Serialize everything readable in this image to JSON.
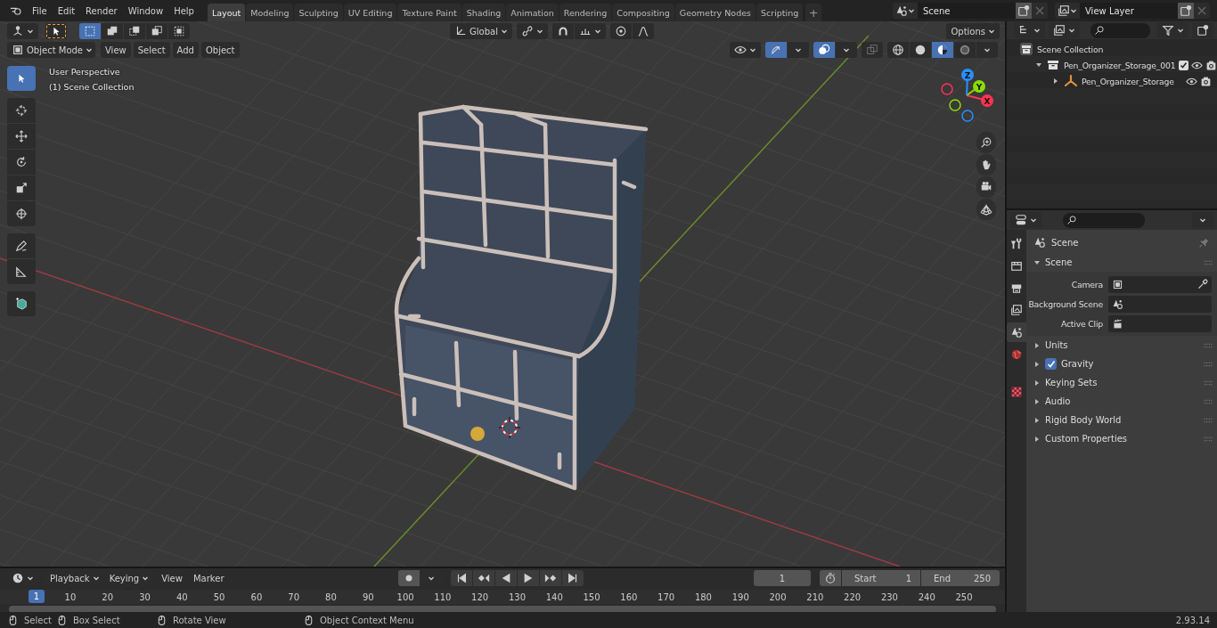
{
  "topbar": {
    "menus": [
      "File",
      "Edit",
      "Render",
      "Window",
      "Help"
    ],
    "workspaces": [
      {
        "label": "Layout",
        "selected": true
      },
      {
        "label": "Modeling",
        "selected": false
      },
      {
        "label": "Sculpting",
        "selected": false
      },
      {
        "label": "UV Editing",
        "selected": false
      },
      {
        "label": "Texture Paint",
        "selected": false
      },
      {
        "label": "Shading",
        "selected": false
      },
      {
        "label": "Animation",
        "selected": false
      },
      {
        "label": "Rendering",
        "selected": false
      },
      {
        "label": "Compositing",
        "selected": false
      },
      {
        "label": "Geometry Nodes",
        "selected": false
      },
      {
        "label": "Scripting",
        "selected": false
      }
    ],
    "add_tab": "+",
    "scene": "Scene",
    "view_layer": "View Layer"
  },
  "viewport": {
    "select_modes": [
      {
        "kind": "set",
        "selected": true
      },
      {
        "kind": "extend",
        "selected": false
      },
      {
        "kind": "subtract",
        "selected": false
      },
      {
        "kind": "difference",
        "selected": false
      },
      {
        "kind": "intersect",
        "selected": false
      }
    ],
    "transform_orientation": "Global",
    "options": "Options",
    "mode": "Object Mode",
    "menus": [
      "View",
      "Select",
      "Add",
      "Object"
    ],
    "toggles": [
      {
        "kind": "gizmo",
        "on": true
      },
      {
        "kind": "overlay",
        "on": true
      },
      {
        "kind": "xray",
        "on": false
      }
    ],
    "shading": [
      {
        "kind": "wireframe",
        "selected": false
      },
      {
        "kind": "solid",
        "selected": false
      },
      {
        "kind": "material",
        "selected": true
      },
      {
        "kind": "rendered",
        "selected": false
      }
    ],
    "tools": [
      {
        "kind": "select",
        "selected": true
      },
      {
        "kind": "cursor",
        "selected": false
      },
      {
        "kind": "move",
        "selected": false
      },
      {
        "kind": "rotate",
        "selected": false
      },
      {
        "kind": "scale",
        "selected": false
      },
      {
        "kind": "transform",
        "selected": false
      },
      {
        "kind": "annotate",
        "selected": false
      },
      {
        "kind": "measure",
        "selected": false
      },
      {
        "kind": "add-cube",
        "selected": false
      }
    ],
    "overlay_text": [
      "User Perspective",
      "(1) Scene Collection"
    ],
    "gizmo_axes": [
      {
        "label": "X",
        "color": "#ff3352"
      },
      {
        "label": "Y",
        "color": "#8bdc00"
      },
      {
        "label": "Z",
        "color": "#2890ff"
      }
    ]
  },
  "outliner": {
    "items": [
      {
        "label": "Scene Collection",
        "kind": "scene-collection",
        "children": [
          {
            "label": "Pen_Organizer_Storage_001",
            "kind": "collection",
            "expanded": true,
            "checked": true,
            "children": [
              {
                "label": "Pen_Organizer_Storage",
                "kind": "empty",
                "expanded": false
              }
            ]
          }
        ]
      }
    ]
  },
  "properties": {
    "tabs": [
      {
        "kind": "tool",
        "selected": false
      },
      {
        "kind": "render",
        "selected": false
      },
      {
        "kind": "output",
        "selected": false
      },
      {
        "kind": "view-layer",
        "selected": false
      },
      {
        "kind": "scene",
        "selected": true
      },
      {
        "kind": "world",
        "selected": false
      },
      {
        "kind": "texture",
        "selected": false
      }
    ],
    "context": "Scene",
    "panels": [
      {
        "label": "Scene",
        "expanded": true,
        "fields": [
          {
            "label": "Camera",
            "kind": "object"
          },
          {
            "label": "Background Scene",
            "kind": "scene"
          },
          {
            "label": "Active Clip",
            "kind": "clip"
          }
        ]
      },
      {
        "label": "Units",
        "expanded": false
      },
      {
        "label": "Gravity",
        "expanded": false,
        "checked": true
      },
      {
        "label": "Keying Sets",
        "expanded": false
      },
      {
        "label": "Audio",
        "expanded": false
      },
      {
        "label": "Rigid Body World",
        "expanded": false
      },
      {
        "label": "Custom Properties",
        "expanded": false
      }
    ]
  },
  "timeline": {
    "menus": [
      {
        "label": "Playback",
        "kind": "dropdown"
      },
      {
        "label": "Keying",
        "kind": "dropdown"
      },
      {
        "label": "View",
        "kind": "plain"
      },
      {
        "label": "Marker",
        "kind": "plain"
      }
    ],
    "current_frame": "1",
    "start_label": "Start",
    "start": "1",
    "end_label": "End",
    "end": "250",
    "frame_marker": "1",
    "ruler": [
      "10",
      "20",
      "30",
      "40",
      "50",
      "60",
      "70",
      "80",
      "90",
      "100",
      "110",
      "120",
      "130",
      "140",
      "150",
      "160",
      "170",
      "180",
      "190",
      "200",
      "210",
      "220",
      "230",
      "240",
      "250"
    ]
  },
  "status_bar": {
    "hints": [
      "Select",
      "Box Select",
      "Rotate View",
      "Object Context Menu"
    ],
    "version": "2.93.14"
  }
}
